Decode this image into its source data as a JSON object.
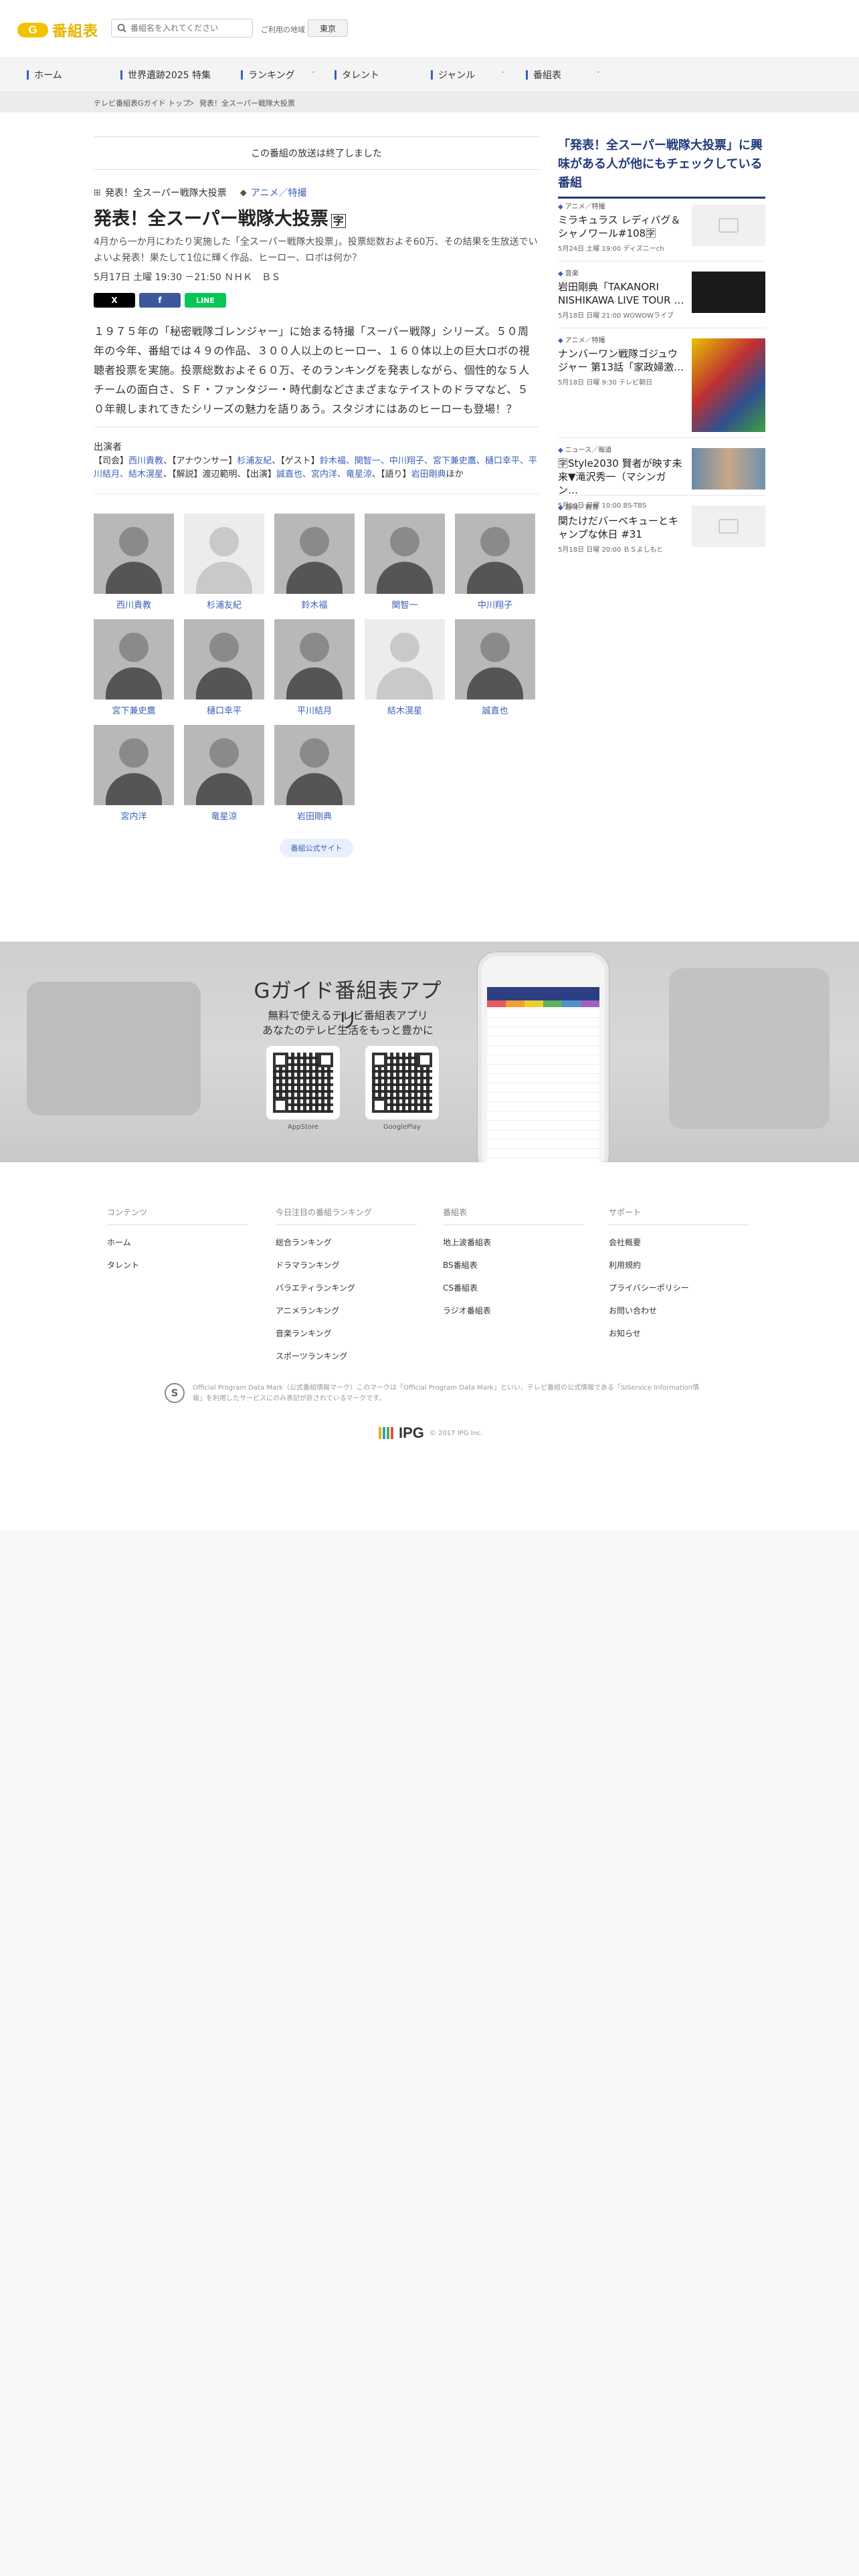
{
  "header": {
    "logo_mark": "G",
    "logo_text": "番組表",
    "search_placeholder": "番組名を入れてください",
    "region_label": "ご利用の地域",
    "region_value": "東京"
  },
  "nav": {
    "items": [
      {
        "label": "ホーム"
      },
      {
        "label": "世界遺跡2025 特集"
      },
      {
        "label": "ランキング"
      },
      {
        "label": "タレント"
      },
      {
        "label": "ジャンル"
      },
      {
        "label": "番組表"
      }
    ]
  },
  "breadcrumb": {
    "items": [
      "テレビ番組表Gガイド トップ",
      "＞",
      "発表！全スーパー戦隊大投票"
    ]
  },
  "program": {
    "ended_notice": "この番組の放送は終了しました",
    "series_tag": "発表！全スーパー戦隊大投票",
    "genre_tag": "アニメ／特撮",
    "title": "発表！全スーパー戦隊大投票",
    "description": "4月から一か月にわたり実施した「全スーパー戦隊大投票」。投票総数およそ60万、その結果を生放送でいよいよ発表！果たして1位に輝く作品、ヒーロー、ロボは何か？",
    "air_time": "5月17日 土曜 19:30 －21:50 ＮＨＫ　ＢＳ",
    "share": {
      "x": "X",
      "facebook": "f",
      "line": "LINE"
    },
    "synopsis": "１９７５年の「秘密戦隊ゴレンジャー」に始まる特撮「スーパー戦隊」シリーズ。５０周年の今年、番組では４９の作品、３００人以上のヒーロー、１６０体以上の巨大ロボの視聴者投票を実施。投票総数およそ６０万、そのランキングを発表しながら、個性的な５人チームの面白さ、ＳＦ・ファンタジー・時代劇などさまざまなテイストのドラマなど、５０年親しまれてきたシリーズの魅力を語りあう。スタジオにはあのヒーローも登場！？",
    "cast_label": "出演者",
    "cast_text_1": "【司会】",
    "cast_text_2": "西川貴教",
    "cast_text_3": "、【アナウンサー】",
    "cast_text_4": "杉浦友紀",
    "cast_text_5": "、【ゲスト】",
    "cast_text_6": "鈴木福、関智一、中川翔子、宮下兼史鷹、樋口幸平、平川結月、結木滉星",
    "cast_text_7": "、【解説】渡辺範明、【出演】",
    "cast_text_8": "誠直也、宮内洋、竜星涼",
    "cast_text_9": "、【語り】",
    "cast_text_10": "岩田剛典",
    "cast_text_11": "ほか",
    "cast_cards": [
      {
        "name": "西川貴教",
        "photo": true
      },
      {
        "name": "杉浦友紀",
        "photo": false
      },
      {
        "name": "鈴木福",
        "photo": true
      },
      {
        "name": "関智一",
        "photo": true
      },
      {
        "name": "中川翔子",
        "photo": true
      },
      {
        "name": "宮下兼史鷹",
        "photo": true
      },
      {
        "name": "樋口幸平",
        "photo": true
      },
      {
        "name": "平川結月",
        "photo": true
      },
      {
        "name": "結木滉星",
        "photo": false
      },
      {
        "name": "誠直也",
        "photo": true
      },
      {
        "name": "宮内洋",
        "photo": true
      },
      {
        "name": "竜星涼",
        "photo": true
      },
      {
        "name": "岩田剛典",
        "photo": true
      }
    ],
    "official_site": "番組公式サイト"
  },
  "sidebar": {
    "title": "「発表！全スーパー戦隊大投票」に興味がある人が他にもチェックしている番組",
    "items": [
      {
        "category": "アニメ／特撮",
        "name": "ミラキュラス レディバグ＆シャノワール#108🈑",
        "date": "5月24日 土曜 19:00 ディズニーch"
      },
      {
        "category": "音楽",
        "name": "岩田剛典「TAKANORI NISHIKAWA LIVE TOUR …",
        "date": "5月18日 日曜 21:00 WOWOWライブ"
      },
      {
        "category": "アニメ／特撮",
        "name": "ナンバーワン戦隊ゴジュウジャー 第13話「家政婦激…",
        "date": "5月18日 日曜 9:30 テレビ朝日"
      },
      {
        "category": "ニュース／報道",
        "name": "🈑Style2030 賢者が映す未来▼滝沢秀一（マシンガン…",
        "date": "5月18日 日曜 10:00 BS-TBS"
      },
      {
        "category": "趣味／教育",
        "name": "関たけだバーベキューとキャンプな休日 #31",
        "date": "5月18日 日曜 20:00 ＢＳよしもと"
      }
    ]
  },
  "app": {
    "title": "Gガイド番組表アプリ",
    "sub1": "無料で使えるテレビ番組表アプリ",
    "sub2": "あなたのテレビ生活をもっと豊かに",
    "appstore": "AppStore",
    "googleplay": "GooglePlay"
  },
  "footer": {
    "columns": [
      {
        "head": "コンテンツ",
        "links": [
          "ホーム",
          "タレント"
        ]
      },
      {
        "head": "今日注目の番組ランキング",
        "links": [
          "総合ランキング",
          "ドラマランキング",
          "バラエティランキング",
          "アニメランキング",
          "音楽ランキング",
          "スポーツランキング"
        ]
      },
      {
        "head": "番組表",
        "links": [
          "地上波番組表",
          "BS番組表",
          "CS番組表",
          "ラジオ番組表"
        ]
      },
      {
        "head": "サポート",
        "links": [
          "会社概要",
          "利用規約",
          "プライバシーポリシー",
          "お問い合わせ",
          "お知らせ"
        ]
      }
    ],
    "disclaimer_logo": "S",
    "disclaimer": "Official Program Data Mark（公式番組情報マーク）このマークは「Official Program Data Mark」といい、テレビ番組の公式情報である「SIService Information情報」を利用したサービスにのみ表記が許されているマークです。",
    "ipg_name": "IPG",
    "copyright": "© 2017 IPG Inc."
  },
  "colors": {
    "accent": "#3a5fb8",
    "brand": "#f2c200",
    "sidebar_title": "#223a7a"
  }
}
